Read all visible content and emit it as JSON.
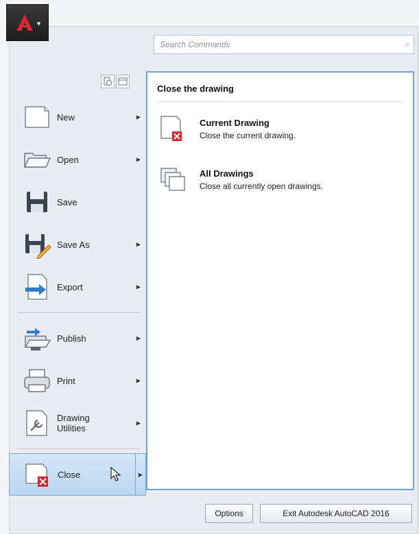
{
  "app_button": {
    "caret": "▾",
    "accent": "#d7262d"
  },
  "search": {
    "placeholder": "Search Commands"
  },
  "recent_icons": [
    "recent-documents-icon",
    "open-documents-icon"
  ],
  "menu": {
    "items": [
      {
        "label": "New",
        "has_submenu": true
      },
      {
        "label": "Open",
        "has_submenu": true
      },
      {
        "label": "Save",
        "has_submenu": false
      },
      {
        "label": "Save As",
        "has_submenu": true
      },
      {
        "label": "Export",
        "has_submenu": true
      },
      {
        "label": "Publish",
        "has_submenu": true
      },
      {
        "label": "Print",
        "has_submenu": true
      },
      {
        "label": "Drawing\nUtilities",
        "has_submenu": true
      },
      {
        "label": "Close",
        "has_submenu": true,
        "active": true
      }
    ]
  },
  "panel": {
    "title": "Close the drawing",
    "items": [
      {
        "title": "Current Drawing",
        "desc": "Close the current drawing."
      },
      {
        "title": "All Drawings",
        "desc": "Close all currently open drawings."
      }
    ]
  },
  "footer": {
    "options": "Options",
    "exit": "Exit Autodesk AutoCAD 2016"
  },
  "colors": {
    "active_bg": "#c6dcf3",
    "active_border": "#7fa7d3",
    "panel_border": "#6ea2d8",
    "red": "#d7262d",
    "blue": "#2f7fd0"
  }
}
